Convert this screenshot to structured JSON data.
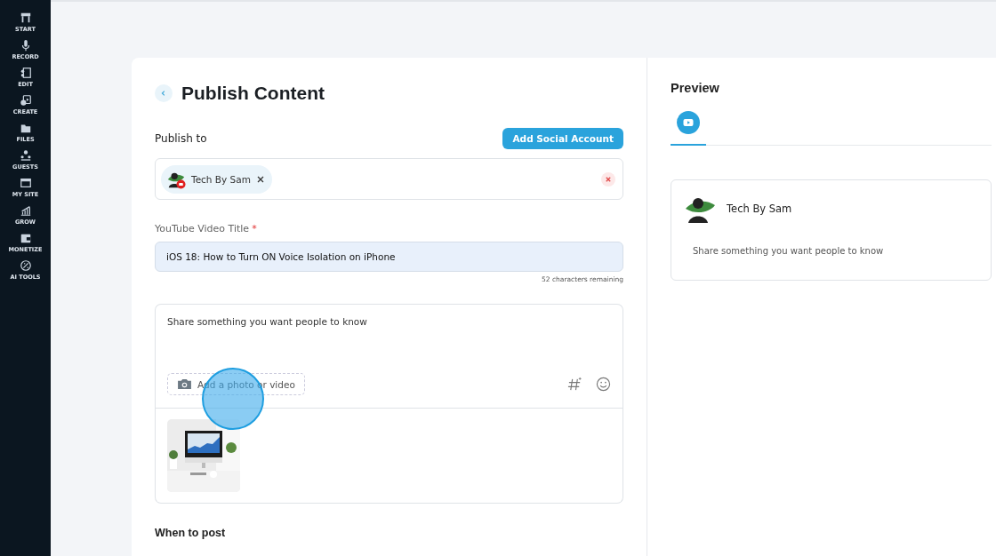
{
  "sidebar": {
    "items": [
      {
        "label": "START"
      },
      {
        "label": "RECORD"
      },
      {
        "label": "EDIT"
      },
      {
        "label": "CREATE"
      },
      {
        "label": "FILES"
      },
      {
        "label": "GUESTS"
      },
      {
        "label": "MY SITE"
      },
      {
        "label": "GROW"
      },
      {
        "label": "MONETIZE"
      },
      {
        "label": "AI TOOLS"
      }
    ]
  },
  "editor": {
    "title": "Publish Content",
    "publish_to_label": "Publish to",
    "add_account_button": "Add Social Account",
    "accounts": [
      {
        "name": "Tech By Sam"
      }
    ],
    "title_field": {
      "label": "YouTube Video Title",
      "required_mark": "*",
      "value": "iOS 18: How to Turn ON Voice Isolation on iPhone",
      "counter": "52 characters remaining"
    },
    "post": {
      "placeholder": "Share something you want people to know",
      "add_media": "Add a photo or video"
    },
    "when_label": "When to post"
  },
  "preview": {
    "title": "Preview",
    "tabs": [
      {
        "selected": true
      }
    ],
    "card": {
      "name": "Tech By Sam",
      "text": "Share something you want people to know"
    }
  }
}
